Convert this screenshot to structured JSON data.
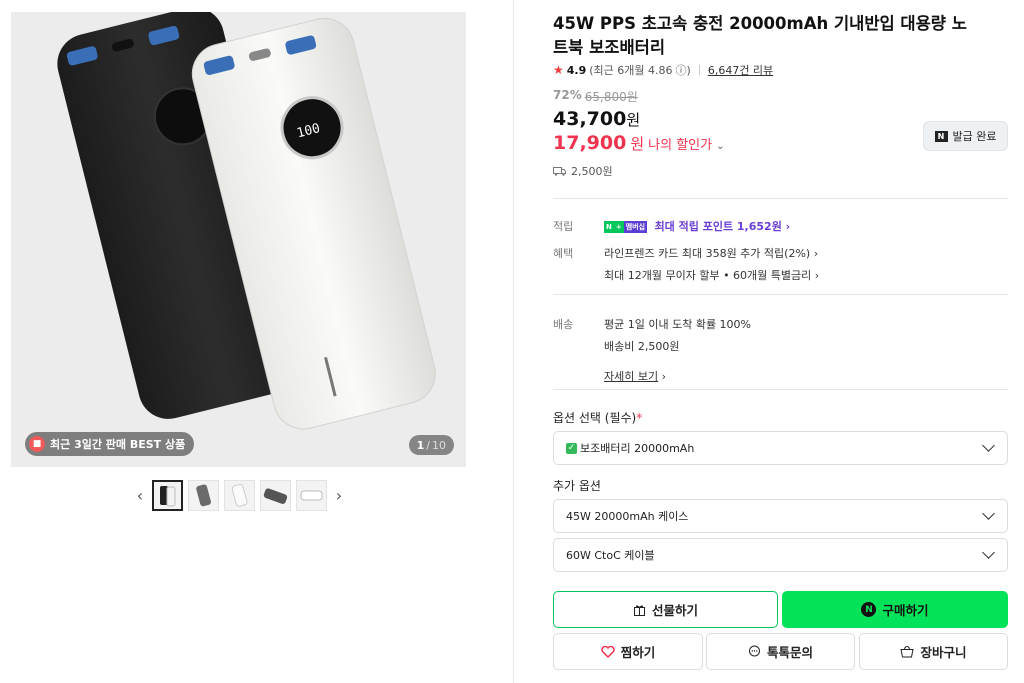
{
  "gallery": {
    "badge_text": "최근 3일간 판매 BEST 상품",
    "page_current": "1",
    "page_sep": "/",
    "page_total": "10",
    "nav_prev": "‹",
    "nav_next": "›",
    "screen_text": "100"
  },
  "product": {
    "title": "45W PPS 초고속 충전 20000mAh 기내반입 대용량 노트북 보조배터리",
    "rating": "4.9",
    "rating_recent": "(최근 6개월 4.86",
    "rating_info": "ⓘ)",
    "review_count": "6,647건 리뷰",
    "discount_rate": "72%",
    "original_price": "65,800원",
    "price": "43,700",
    "price_unit": "원",
    "my_price": "17,900",
    "my_price_unit": "원",
    "my_price_label": "나의 할인가",
    "coupon_label": "발급 완료",
    "shipping_cost": "2,500원"
  },
  "benefits": {
    "points_key": "적립",
    "points_badge_n": "N",
    "points_badge_plus": "+",
    "points_badge_membership": "멤버십",
    "points_text": "최대 적립 포인트",
    "points_value": "1,652원",
    "benefit_key": "혜택",
    "benefit_line1": "라인프렌즈 카드 최대 358원 추가 적립(2%)",
    "benefit_line2": "최대 12개월 무이자 할부 • 60개월 특별금리"
  },
  "delivery": {
    "key": "배송",
    "line1": "평균 1일 이내 도착 확률 100%",
    "line2": "배송비 2,500원",
    "detail_link": "자세히 보기"
  },
  "options": {
    "required_label": "옵션 선택 (필수)",
    "required_mark": "*",
    "required_value": "보조배터리 20000mAh",
    "extra_label": "추가 옵션",
    "extra1": "45W 20000mAh 케이스",
    "extra2": "60W CtoC 케이블"
  },
  "actions": {
    "gift": "선물하기",
    "buy": "구매하기",
    "wish": "찜하기",
    "talk": "톡톡문의",
    "cart": "장바구니"
  },
  "colors": {
    "accent_red": "#f0344f",
    "naver_green": "#03e35a",
    "point_purple": "#6a3fd4"
  }
}
